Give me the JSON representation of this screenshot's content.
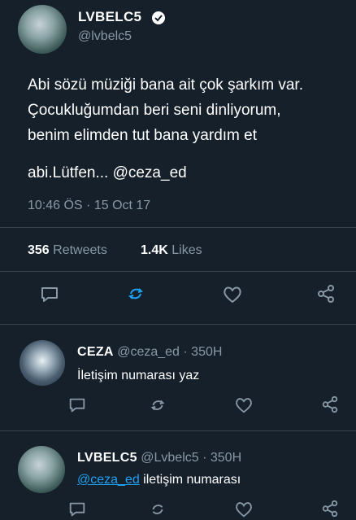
{
  "tweet": {
    "author_name": "LVBELC5",
    "author_handle": "@lvbelc5",
    "text_line1": "Abi sözü müziği bana ait çok şarkım var.",
    "text_line2": "Çocukluğumdan beri seni dinliyorum,",
    "text_line3": "benim elimden tut bana yardım et",
    "text_line4": "abi.Lütfen... @ceza_ed",
    "timestamp": "10:46 ÖS · 15 Oct 17",
    "retweets_count": "356",
    "retweets_label": "Retweets",
    "likes_count": "1.4K",
    "likes_label": "Likes"
  },
  "replies": [
    {
      "name": "CEZA",
      "handle_time": "@ceza_ed · 350H",
      "text": "İletişim numarası yaz"
    },
    {
      "name": "LVBELC5",
      "handle_time": "@Lvbelc5 · 350H",
      "mention": "@ceza_ed",
      "text": " iletişim numarası"
    }
  ],
  "colors": {
    "background": "#15202b",
    "muted": "#8899a6",
    "accent": "#1da1f2",
    "divider": "#38444d"
  },
  "icons": [
    "reply-icon",
    "retweet-icon",
    "like-icon",
    "share-icon",
    "verified-icon"
  ]
}
